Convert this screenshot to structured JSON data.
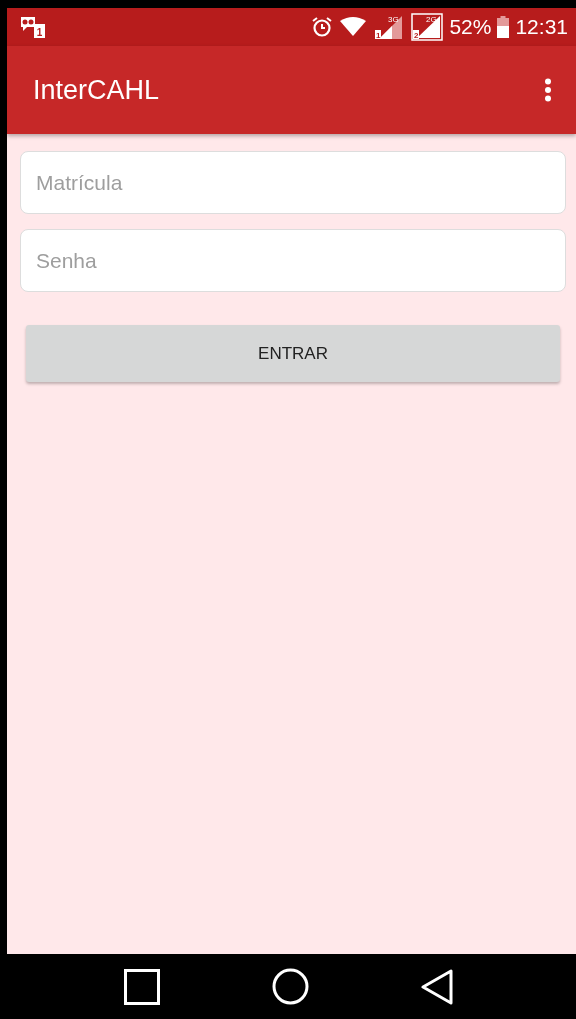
{
  "status_bar": {
    "notification_badge": "1",
    "signals": [
      {
        "network": "3G",
        "sim": "1"
      },
      {
        "network": "2G",
        "sim": "2"
      }
    ],
    "battery": "52%",
    "time": "12:31"
  },
  "app_bar": {
    "title": "InterCAHL"
  },
  "fields": [
    {
      "placeholder": "Matrícula"
    },
    {
      "placeholder": "Senha"
    }
  ],
  "button": {
    "label": "ENTRAR"
  }
}
